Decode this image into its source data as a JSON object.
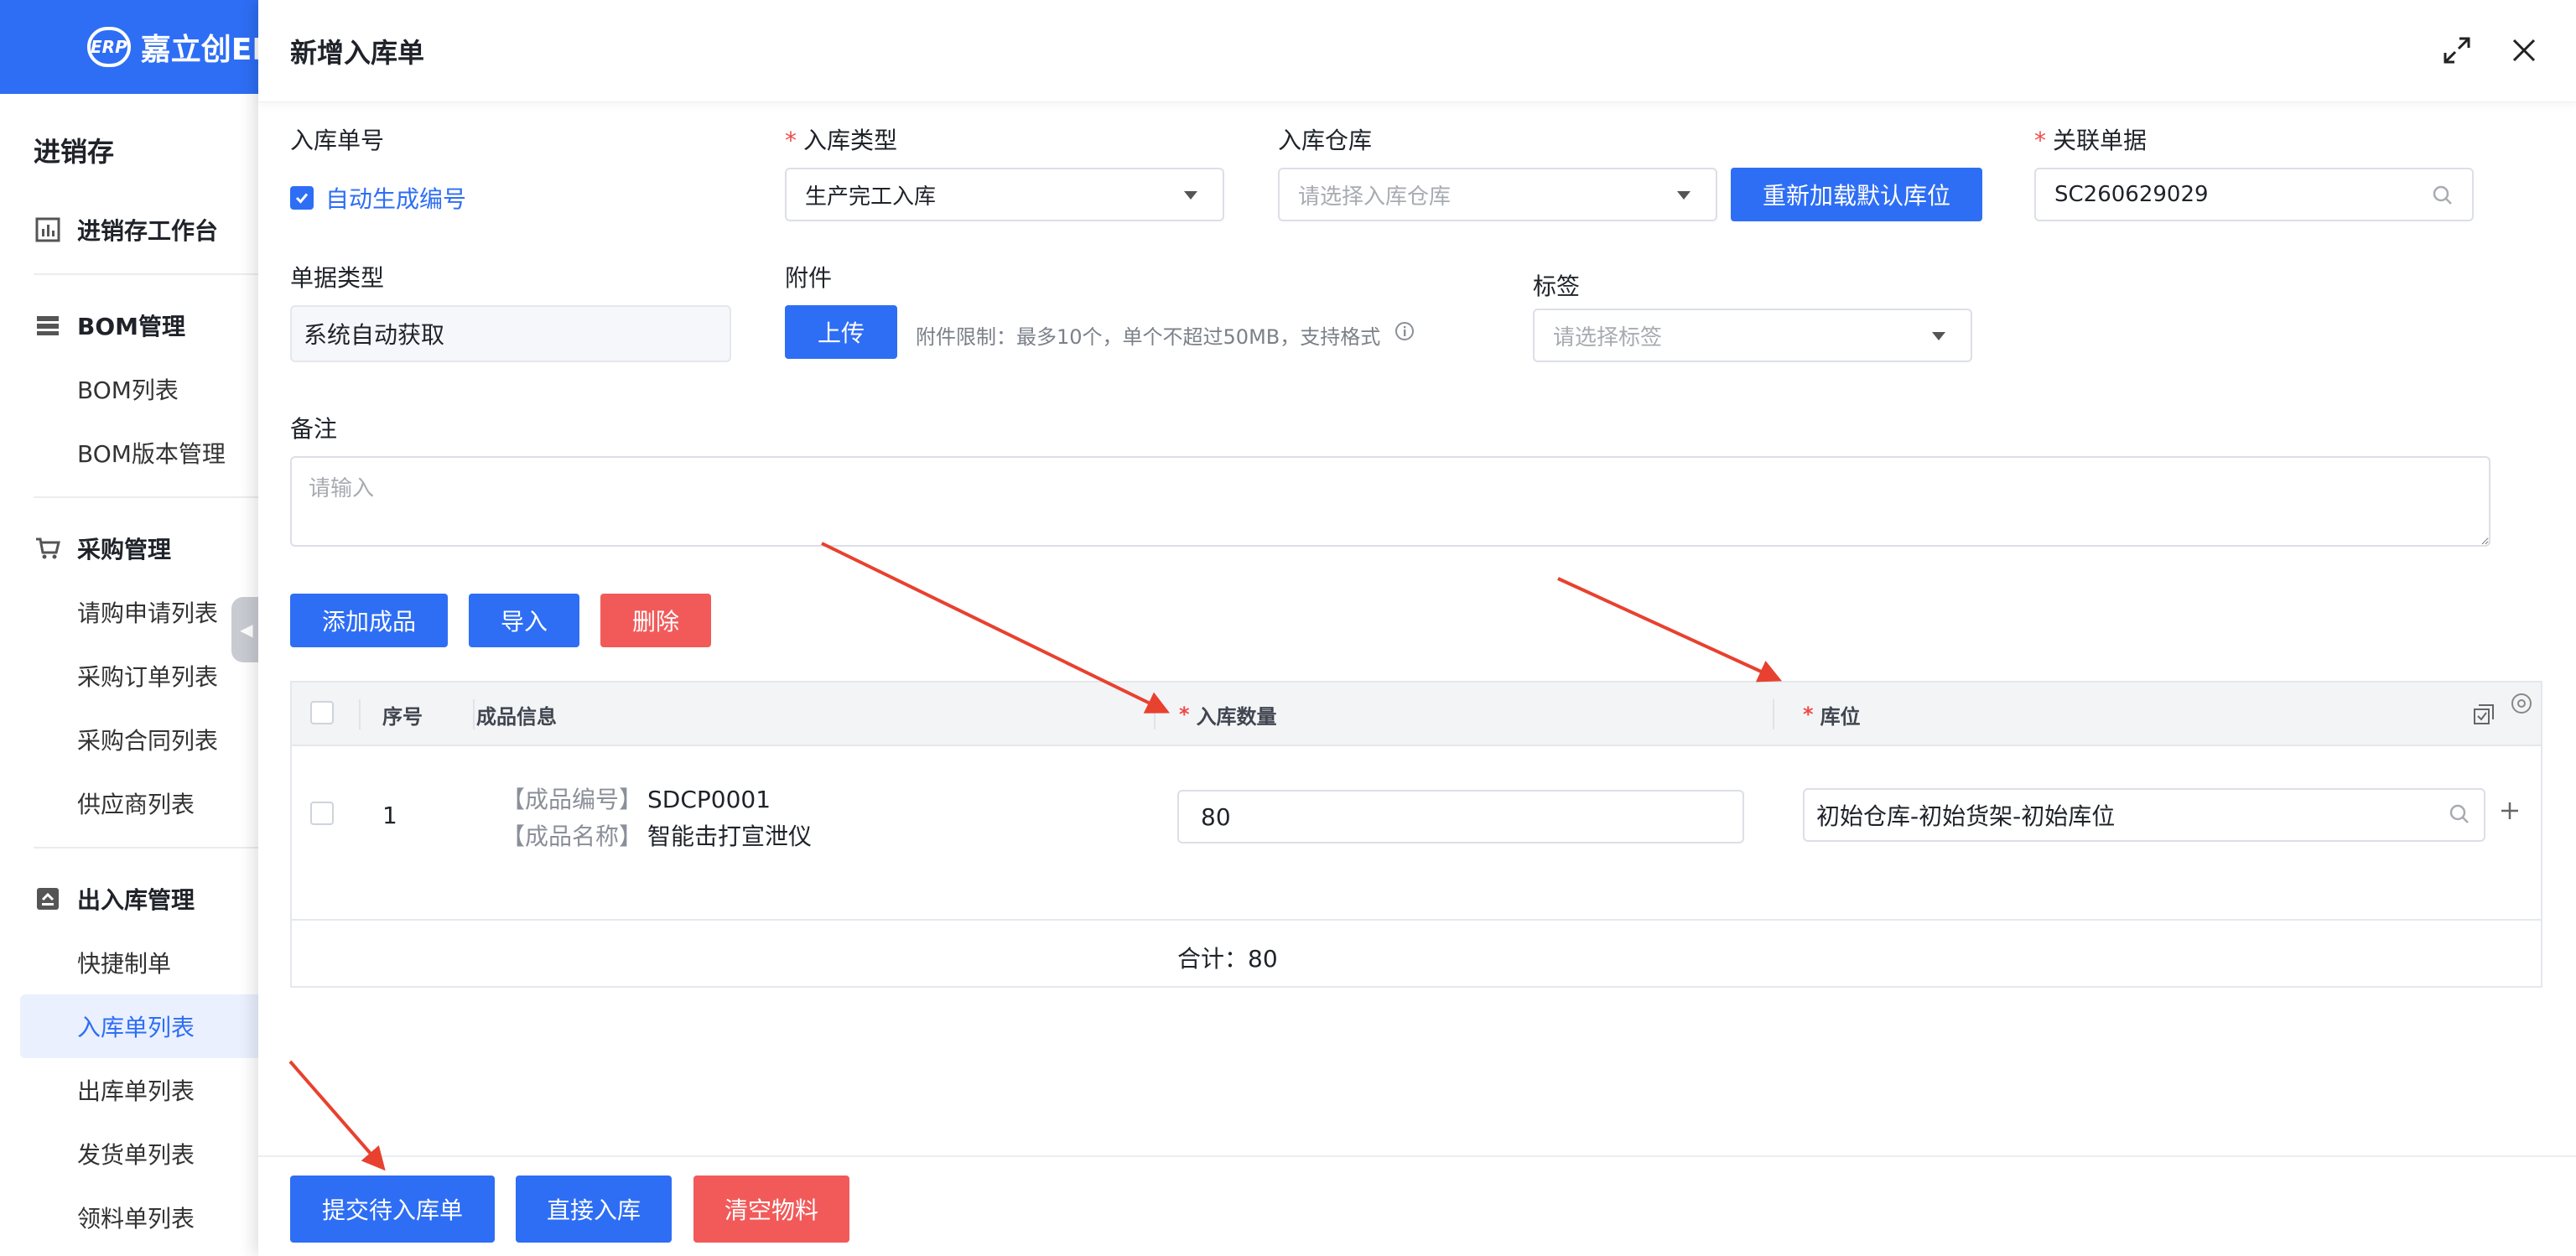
{
  "sidebar": {
    "logo_mark": "ERP",
    "logo_text": "嘉立创ERP",
    "title": "进销存",
    "groups": [
      {
        "label": "进销存工作台",
        "items": []
      },
      {
        "label": "BOM管理",
        "items": [
          "BOM列表",
          "BOM版本管理"
        ]
      },
      {
        "label": "采购管理",
        "items": [
          "请购申请列表",
          "采购订单列表",
          "采购合同列表",
          "供应商列表"
        ]
      },
      {
        "label": "出入库管理",
        "items": [
          "快捷制单",
          "入库单列表",
          "出库单列表",
          "发货单列表",
          "领料单列表"
        ]
      }
    ],
    "active_item": "入库单列表"
  },
  "drawer": {
    "title": "新增入库单",
    "fields": {
      "order_no_label": "入库单号",
      "auto_generate_label": "自动生成编号",
      "auto_generate_checked": true,
      "type_label": "入库类型",
      "type_value": "生产完工入库",
      "warehouse_label": "入库仓库",
      "warehouse_placeholder": "请选择入库仓库",
      "reload_button": "重新加载默认库位",
      "related_label": "关联单据",
      "related_value": "SC260629029",
      "doc_type_label": "单据类型",
      "doc_type_value": "系统自动获取",
      "attachment_label": "附件",
      "upload_button": "上传",
      "attachment_hint": "附件限制：最多10个，单个不超过50MB，支持格式",
      "tag_label": "标签",
      "tag_placeholder": "请选择标签",
      "remark_label": "备注",
      "remark_placeholder": "请输入"
    },
    "actions": {
      "add_product": "添加成品",
      "import": "导入",
      "delete": "删除"
    },
    "table": {
      "headers": {
        "index": "序号",
        "product_info": "成品信息",
        "quantity": "入库数量",
        "location": "库位"
      },
      "rows": [
        {
          "index": "1",
          "code_key": "【成品编号】",
          "code": "SDCP0001",
          "name_key": "【成品名称】",
          "name": "智能击打宣泄仪",
          "quantity": "80",
          "location": "初始仓库-初始货架-初始库位"
        }
      ],
      "total_label": "合计：",
      "total_value": "80"
    },
    "footer": {
      "submit_pending": "提交待入库单",
      "direct_stock_in": "直接入库",
      "clear_materials": "清空物料"
    }
  },
  "colors": {
    "primary": "#2e6ef5",
    "danger": "#f25a5a",
    "annotation_arrow": "#e8412f",
    "required_star": "#f04a4a"
  }
}
